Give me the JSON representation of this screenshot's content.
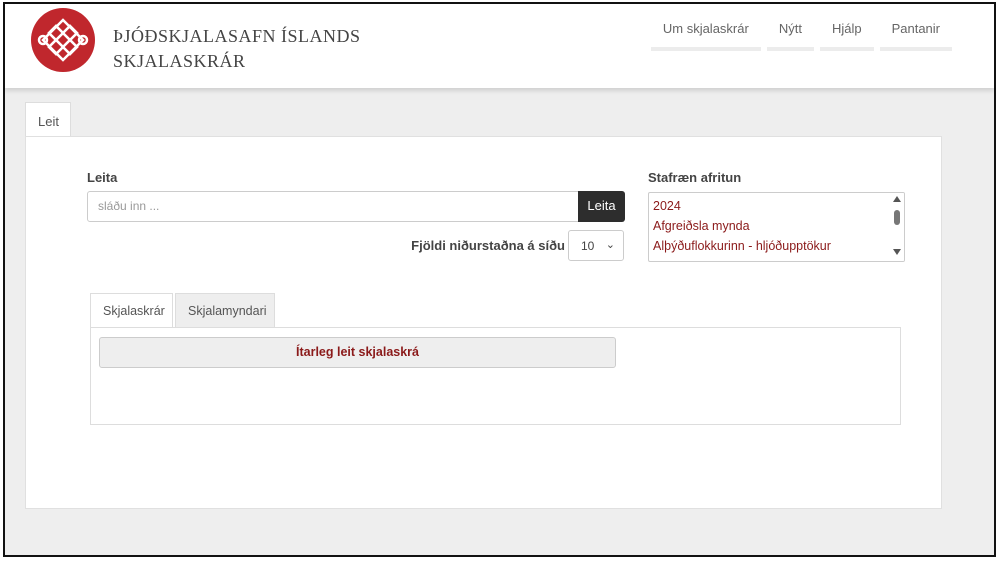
{
  "site": {
    "title_line1": "ÞJÓÐSKJALASAFN ÍSLANDS",
    "title_line2": "SKJALASKRÁR"
  },
  "nav": [
    {
      "label": "Um skjalaskrár"
    },
    {
      "label": "Nýtt"
    },
    {
      "label": "Hjálp"
    },
    {
      "label": "Pantanir"
    }
  ],
  "main_tab": {
    "label": "Leit"
  },
  "search": {
    "label": "Leita",
    "placeholder": "sláðu inn ...",
    "button_label": "Leita",
    "count_label": "Fjöldi niðurstaðna á síðu",
    "count_value": "10"
  },
  "digital": {
    "label": "Stafræn afritun",
    "options": [
      "2024",
      "Afgreiðsla mynda",
      "Alþýðuflokkurinn - hljóðupptökur"
    ]
  },
  "subtabs": [
    {
      "label": "Skjalaskrár"
    },
    {
      "label": "Skjalamyndari"
    }
  ],
  "advanced_button": "Ítarleg leit skjalaskrá",
  "colors": {
    "accent": "#8b1a1a",
    "logo": "#c0272d",
    "button_dark": "#2d2d2d"
  },
  "icons": {
    "logo": "endless-knot-logo",
    "select": "chevron-down-icon"
  }
}
